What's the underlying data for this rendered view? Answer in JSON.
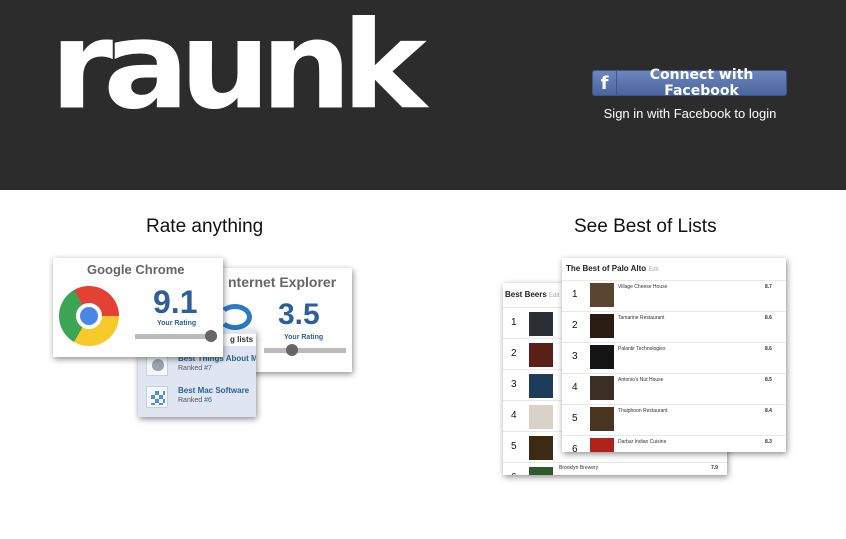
{
  "header": {
    "logo": "raunk",
    "facebook_button": "Connect with Facebook",
    "facebook_icon_letter": "f",
    "signin_text": "Sign in with Facebook to login"
  },
  "sections": {
    "rate_title": "Rate anything",
    "best_title": "See Best of Lists"
  },
  "rate_collage": {
    "chrome": {
      "name": "Google Chrome",
      "score": "9.1",
      "label": "Your Rating"
    },
    "ie": {
      "name": "nternet Explorer",
      "score": "3.5",
      "label": "Your Rating"
    },
    "lists_header": "g lists",
    "lists": [
      {
        "name": "Best Things About M",
        "rank_prefix": "Ranked ",
        "rank": "#7",
        "icon": "apple-icon"
      },
      {
        "name": "Best Mac Software",
        "rank_prefix": "Ranked ",
        "rank": "#6",
        "icon": "dropbox-icon"
      }
    ]
  },
  "best_collage": {
    "beers": {
      "title": "Best Beers",
      "edit": "Edit",
      "rows": [
        {
          "num": "1"
        },
        {
          "num": "2"
        },
        {
          "num": "3"
        },
        {
          "num": "4"
        },
        {
          "num": "5"
        },
        {
          "num": "6",
          "name": "Brooklyn Brewery",
          "score": "7.9"
        }
      ]
    },
    "palo_alto": {
      "title": "The Best of Palo Alto",
      "edit": "Edit",
      "rows": [
        {
          "num": "1",
          "name": "Village Cheese House",
          "score": "8.7"
        },
        {
          "num": "2",
          "name": "Tamarine Restaurant",
          "score": "8.6"
        },
        {
          "num": "3",
          "name": "Palantir Technologies",
          "score": "8.6"
        },
        {
          "num": "4",
          "name": "Antonio's Nut House",
          "score": "8.5"
        },
        {
          "num": "5",
          "name": "Thaiphoon Restaurant",
          "score": "8.4"
        },
        {
          "num": "6",
          "name": "Darbar Indian Cuisine",
          "score": "8.3"
        }
      ]
    }
  },
  "colors": {
    "header_bg": "#2d2c2c",
    "facebook_blue": "#4a64a0",
    "rating_blue": "#2c5f9e"
  }
}
